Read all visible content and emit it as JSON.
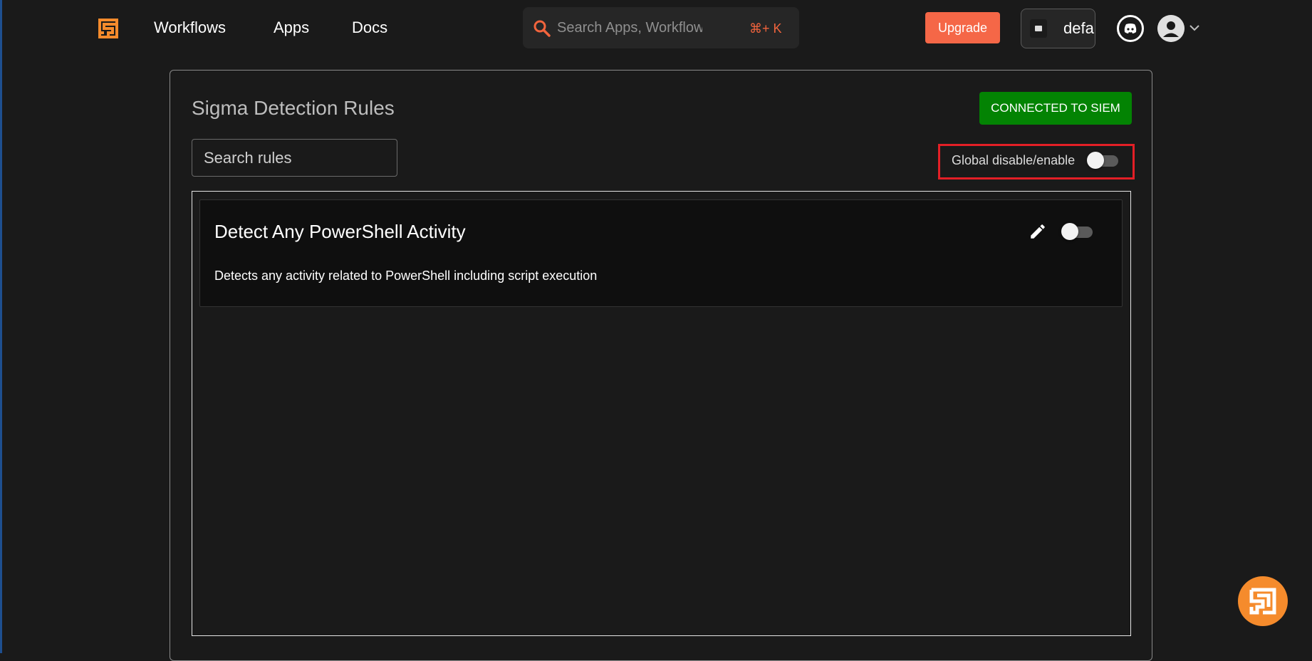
{
  "nav": {
    "links": [
      "Workflows",
      "Apps",
      "Docs"
    ],
    "search": {
      "placeholder": "Search Apps, Workflows, Docs...",
      "text": "Search Apps, Workflows, D",
      "shortcut": "⌘+ K"
    },
    "upgrade_label": "Upgrade",
    "org_name": "defa",
    "icons": [
      "shuffle-logo-icon",
      "search-icon",
      "discord-icon",
      "account-icon",
      "chevron-down-icon"
    ]
  },
  "page": {
    "title": "Sigma Detection Rules",
    "siem_button": "CONNECTED TO SIEM",
    "search_placeholder": "Search rules",
    "global_toggle_label": "Global disable/enable",
    "global_toggle_on": false
  },
  "rules": [
    {
      "title": "Detect Any PowerShell Activity",
      "description": "Detects any activity related to PowerShell including script execution",
      "enabled": false
    }
  ],
  "colors": {
    "background": "#1a1a1a",
    "accent": "#f56747",
    "siem_green": "#038303",
    "highlight_red": "#e31f26",
    "fab_orange": "#f58b2c"
  }
}
